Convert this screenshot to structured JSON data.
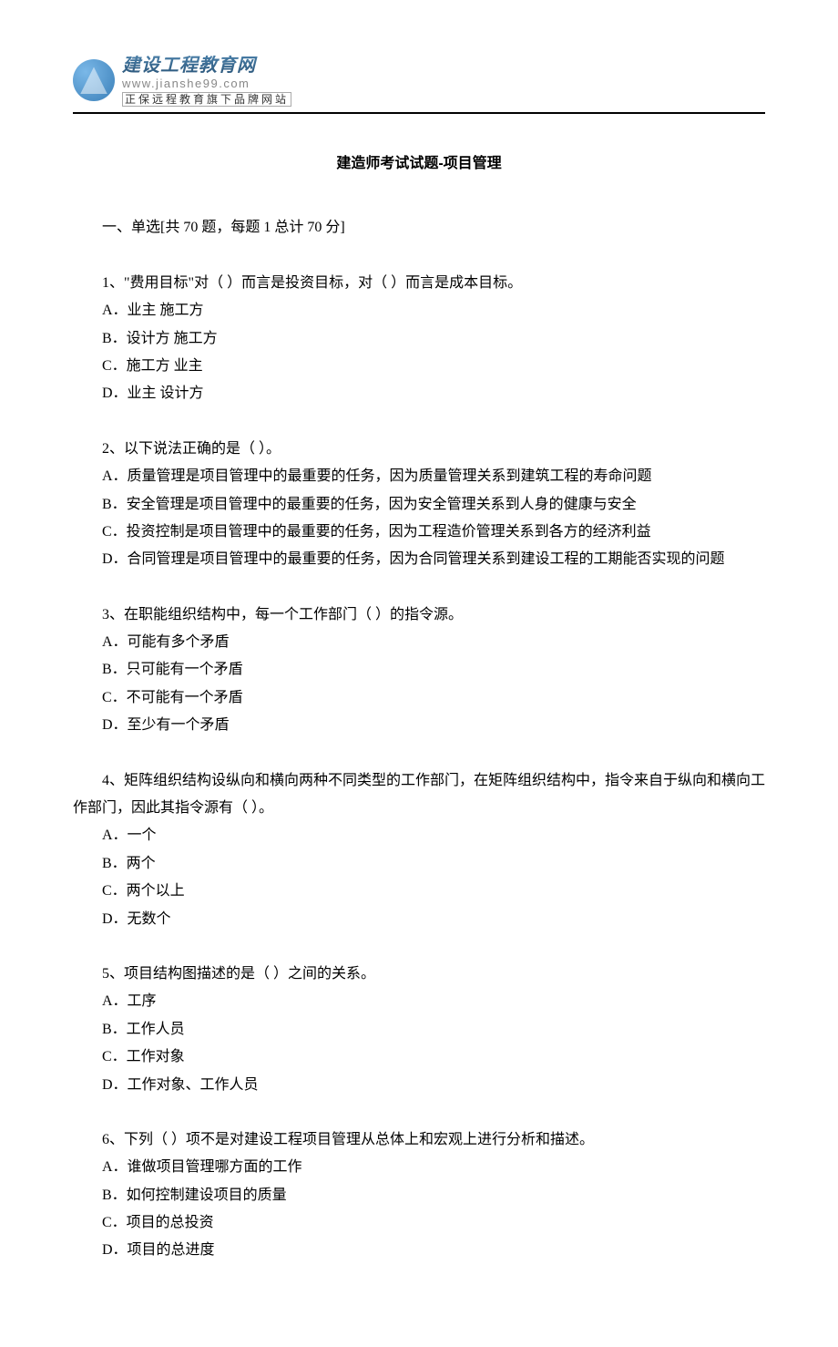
{
  "logo": {
    "title": "建设工程教育网",
    "url": "www.jianshe99.com",
    "tagline": "正保远程教育旗下品牌网站"
  },
  "doc_title": "建造师考试试题-项目管理",
  "section_intro": "一、单选[共 70 题，每题 1 总计 70 分]",
  "questions": [
    {
      "text": "1、\"费用目标\"对（  ）而言是投资目标，对（  ）而言是成本目标。",
      "options": [
        "A．业主  施工方",
        "B．设计方  施工方",
        "C．施工方  业主",
        "D．业主  设计方"
      ]
    },
    {
      "text": "2、以下说法正确的是（  ）。",
      "options": [
        "A．质量管理是项目管理中的最重要的任务，因为质量管理关系到建筑工程的寿命问题",
        "B．安全管理是项目管理中的最重要的任务，因为安全管理关系到人身的健康与安全",
        "C．投资控制是项目管理中的最重要的任务，因为工程造价管理关系到各方的经济利益",
        "D．合同管理是项目管理中的最重要的任务，因为合同管理关系到建设工程的工期能否实现的问题"
      ]
    },
    {
      "text": "3、在职能组织结构中，每一个工作部门（  ）的指令源。",
      "options": [
        "A．可能有多个矛盾",
        "B．只可能有一个矛盾",
        "C．不可能有一个矛盾",
        "D．至少有一个矛盾"
      ]
    },
    {
      "text": "4、矩阵组织结构设纵向和横向两种不同类型的工作部门，在矩阵组织结构中，指令来自于纵向和横向工作部门，因此其指令源有（  ）。",
      "options": [
        "A．一个",
        "B．两个",
        "C．两个以上",
        "D．无数个"
      ]
    },
    {
      "text": "5、项目结构图描述的是（  ）之间的关系。",
      "options": [
        "A．工序",
        "B．工作人员",
        "C．工作对象",
        "D．工作对象、工作人员"
      ]
    },
    {
      "text": "6、下列（  ）项不是对建设工程项目管理从总体上和宏观上进行分析和描述。",
      "options": [
        "A．谁做项目管理哪方面的工作",
        "B．如何控制建设项目的质量",
        "C．项目的总投资",
        "D．项目的总进度"
      ]
    }
  ]
}
